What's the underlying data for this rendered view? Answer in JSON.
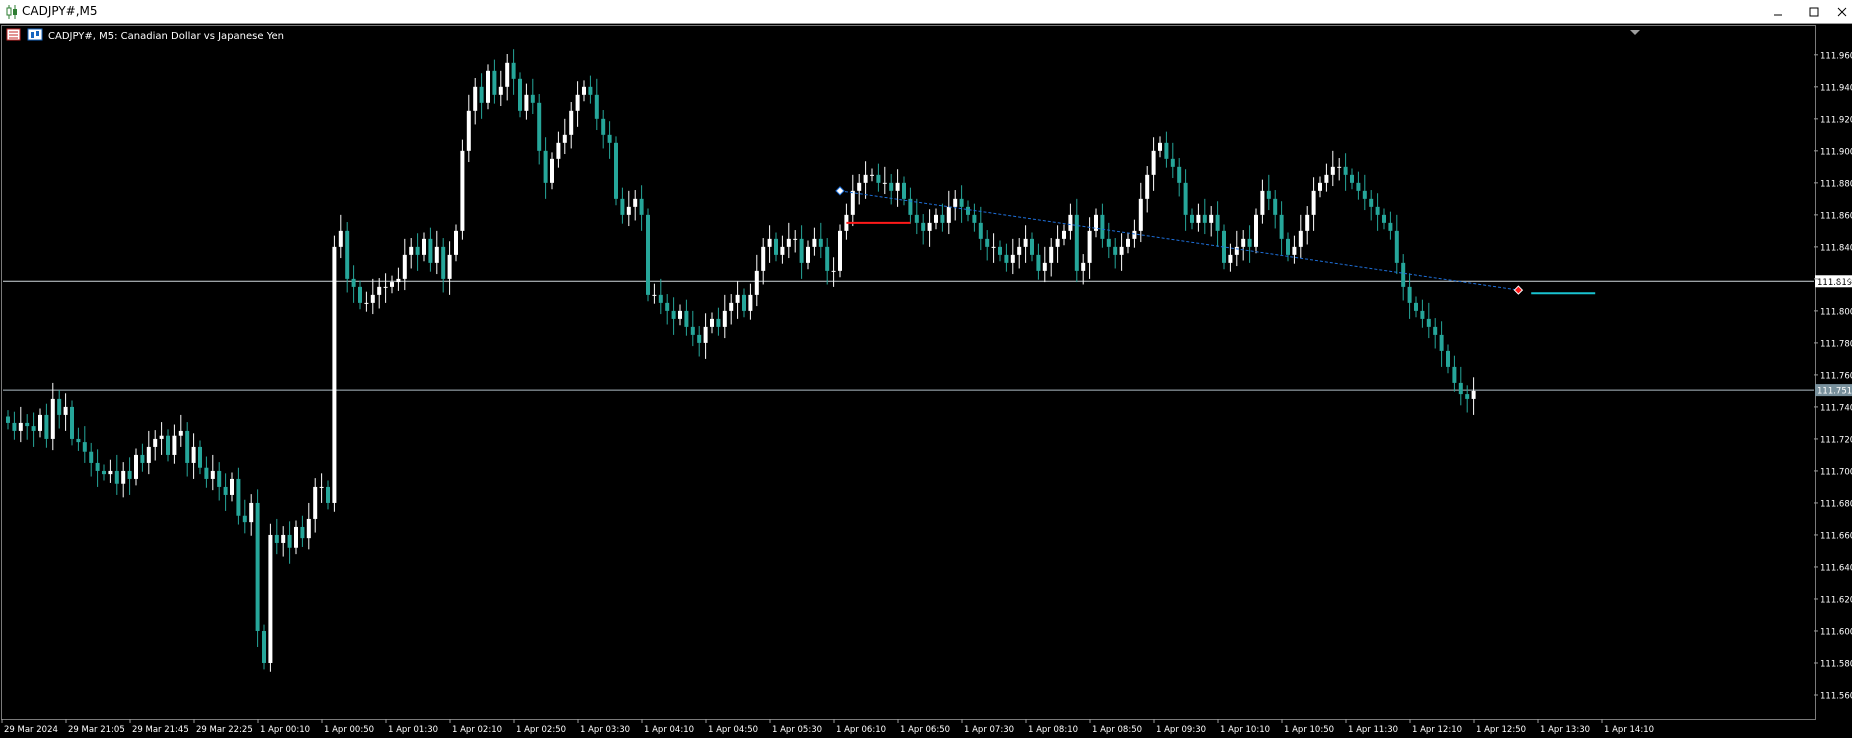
{
  "window": {
    "title": "CADJPY#,M5",
    "controls": [
      "minimize",
      "maximize",
      "close"
    ]
  },
  "chart_header": {
    "label": "CADJPY#, M5:  Canadian Dollar vs Japanese Yen"
  },
  "colors": {
    "background": "#000000",
    "bull": "#ffffff",
    "bear": "#26a69a",
    "grid_line": "#cfd8dc",
    "bid_line": "#b0bec5",
    "trendline": "#1e6fd9",
    "marker_red": "#ff1a1a",
    "marker_cyan": "#19c3d1"
  },
  "chart_data": {
    "type": "candlestick",
    "symbol": "CADJPY#",
    "timeframe": "M5",
    "ylim": [
      111.545,
      111.978
    ],
    "y_ticks": [
      "111.960",
      "111.940",
      "111.920",
      "111.900",
      "111.880",
      "111.860",
      "111.840",
      "111.820",
      "111.800",
      "111.780",
      "111.760",
      "111.740",
      "111.720",
      "111.700",
      "111.680",
      "111.660",
      "111.640",
      "111.620",
      "111.600",
      "111.580",
      "111.560"
    ],
    "x_ticks": [
      {
        "index": 0,
        "label": "29 Mar 2024"
      },
      {
        "index": 10,
        "label": "29 Mar 21:05"
      },
      {
        "index": 20,
        "label": "29 Mar 21:45"
      },
      {
        "index": 30,
        "label": "29 Mar 22:25"
      },
      {
        "index": 40,
        "label": "1 Apr 00:10"
      },
      {
        "index": 50,
        "label": "1 Apr 00:50"
      },
      {
        "index": 60,
        "label": "1 Apr 01:30"
      },
      {
        "index": 70,
        "label": "1 Apr 02:10"
      },
      {
        "index": 80,
        "label": "1 Apr 02:50"
      },
      {
        "index": 90,
        "label": "1 Apr 03:30"
      },
      {
        "index": 100,
        "label": "1 Apr 04:10"
      },
      {
        "index": 110,
        "label": "1 Apr 04:50"
      },
      {
        "index": 120,
        "label": "1 Apr 05:30"
      },
      {
        "index": 130,
        "label": "1 Apr 06:10"
      },
      {
        "index": 140,
        "label": "1 Apr 06:50"
      },
      {
        "index": 150,
        "label": "1 Apr 07:30"
      },
      {
        "index": 160,
        "label": "1 Apr 08:10"
      },
      {
        "index": 170,
        "label": "1 Apr 08:50"
      },
      {
        "index": 180,
        "label": "1 Apr 09:30"
      },
      {
        "index": 190,
        "label": "1 Apr 10:10"
      },
      {
        "index": 200,
        "label": "1 Apr 10:50"
      },
      {
        "index": 210,
        "label": "1 Apr 11:30"
      },
      {
        "index": 220,
        "label": "1 Apr 12:10"
      },
      {
        "index": 230,
        "label": "1 Apr 12:50"
      },
      {
        "index": 240,
        "label": "1 Apr 13:30"
      },
      {
        "index": 250,
        "label": "1 Apr 14:10"
      }
    ],
    "hlines": [
      {
        "price": 111.8185,
        "label": "111.819",
        "style": "grid"
      },
      {
        "price": 111.7505,
        "label": "111.751",
        "style": "bid"
      }
    ],
    "trendline": {
      "from": {
        "index": 130,
        "price": 111.875
      },
      "to": {
        "index": 236,
        "price": 111.813
      }
    },
    "segments": [
      {
        "from_index": 131,
        "to_index": 141,
        "price": 111.855,
        "color": "red"
      },
      {
        "from_index": 238,
        "to_index": 248,
        "price": 111.811,
        "color": "cyan"
      }
    ],
    "markers": [
      {
        "index": 130,
        "price": 111.875,
        "color": "blue"
      },
      {
        "index": 236,
        "price": 111.813,
        "color": "red"
      }
    ],
    "close_series": [
      111.73,
      111.725,
      111.73,
      111.728,
      111.725,
      111.735,
      111.72,
      111.745,
      111.735,
      111.74,
      111.72,
      111.718,
      111.712,
      111.705,
      111.7,
      111.698,
      111.7,
      111.692,
      111.7,
      111.695,
      111.71,
      111.705,
      111.715,
      111.72,
      111.722,
      111.71,
      111.722,
      111.725,
      111.705,
      111.715,
      111.702,
      111.695,
      111.7,
      111.69,
      111.685,
      111.695,
      111.672,
      111.668,
      111.68,
      111.6,
      111.58,
      111.66,
      111.655,
      111.66,
      111.652,
      111.665,
      111.658,
      111.67,
      111.69,
      111.69,
      111.68,
      111.84,
      111.85,
      111.82,
      111.815,
      111.805,
      111.805,
      111.81,
      111.815,
      111.815,
      111.818,
      111.82,
      111.835,
      111.84,
      111.835,
      111.845,
      111.83,
      111.84,
      111.82,
      111.835,
      111.85,
      111.9,
      111.925,
      111.94,
      111.93,
      111.95,
      111.935,
      111.94,
      111.955,
      111.945,
      111.925,
      111.935,
      111.93,
      111.9,
      111.88,
      111.895,
      111.905,
      111.91,
      111.925,
      111.935,
      111.94,
      111.935,
      111.92,
      111.91,
      111.905,
      111.87,
      111.86,
      111.865,
      111.87,
      111.86,
      111.81,
      111.81,
      111.805,
      111.8,
      111.795,
      111.8,
      111.79,
      111.785,
      111.78,
      111.79,
      111.795,
      111.79,
      111.8,
      111.805,
      111.81,
      111.8,
      111.81,
      111.825,
      111.84,
      111.845,
      111.835,
      111.84,
      111.845,
      111.845,
      111.83,
      111.84,
      111.845,
      111.84,
      111.825,
      111.825,
      111.85,
      111.86,
      111.875,
      111.88,
      111.885,
      111.885,
      111.88,
      111.88,
      111.875,
      111.88,
      111.87,
      111.86,
      111.855,
      111.85,
      111.855,
      111.86,
      111.855,
      111.865,
      111.87,
      111.865,
      111.86,
      111.855,
      111.845,
      111.84,
      111.84,
      111.835,
      111.83,
      111.835,
      111.84,
      111.845,
      111.835,
      111.825,
      111.83,
      111.84,
      111.845,
      111.85,
      111.86,
      111.825,
      111.83,
      111.85,
      111.86,
      111.845,
      111.84,
      111.835,
      111.84,
      111.845,
      111.85,
      111.87,
      111.885,
      111.9,
      111.905,
      111.895,
      111.89,
      111.88,
      111.86,
      111.855,
      111.86,
      111.855,
      111.86,
      111.85,
      111.83,
      111.835,
      111.84,
      111.845,
      111.84,
      111.86,
      111.875,
      111.87,
      111.86,
      111.845,
      111.835,
      111.84,
      111.85,
      111.86,
      111.875,
      111.88,
      111.885,
      111.89,
      111.89,
      111.885,
      111.88,
      111.875,
      111.87,
      111.865,
      111.86,
      111.855,
      111.85,
      111.83,
      111.815,
      111.805,
      111.8,
      111.795,
      111.79,
      111.785,
      111.775,
      111.765,
      111.755,
      111.748,
      111.745,
      111.75
    ]
  }
}
